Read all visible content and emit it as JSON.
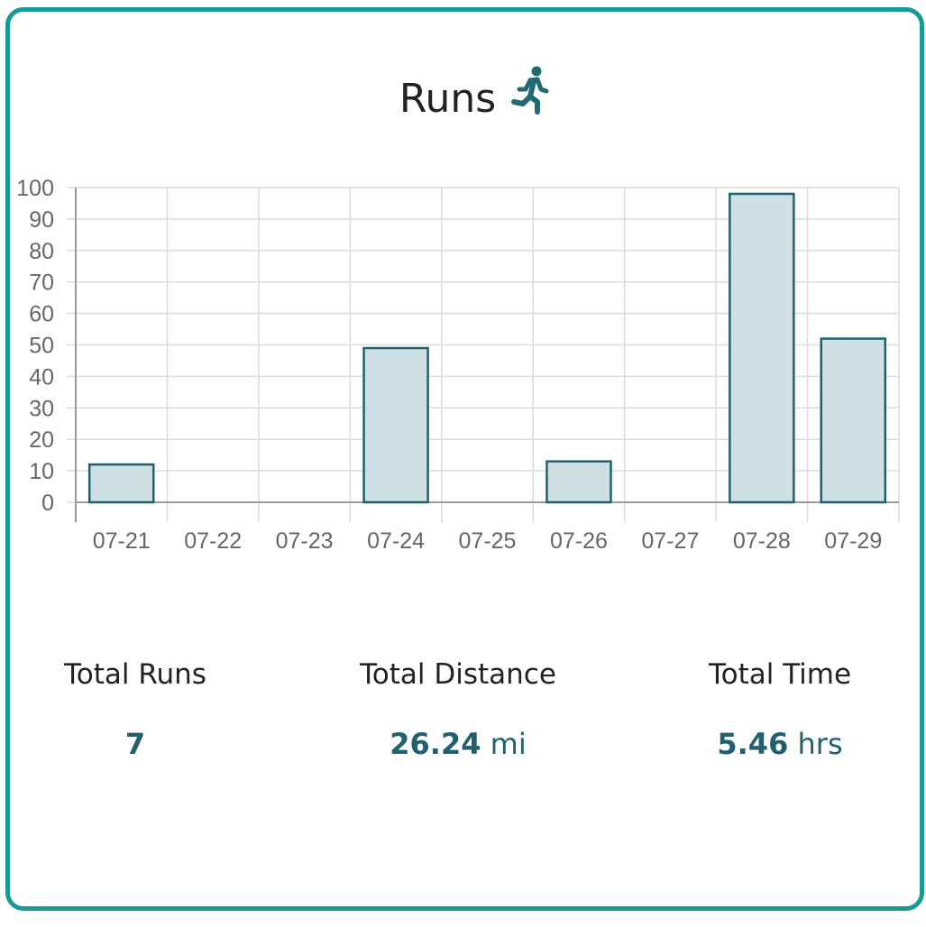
{
  "card": {
    "title": "Runs",
    "icon": "running-person-icon",
    "border_color": "#159a96",
    "accent_color": "#21616f"
  },
  "chart_data": {
    "type": "bar",
    "categories": [
      "07-21",
      "07-22",
      "07-23",
      "07-24",
      "07-25",
      "07-26",
      "07-27",
      "07-28",
      "07-29"
    ],
    "values": [
      12,
      0,
      0,
      49,
      0,
      13,
      0,
      98,
      52
    ],
    "ylim": [
      0,
      100
    ],
    "yticks": [
      0,
      10,
      20,
      30,
      40,
      50,
      60,
      70,
      80,
      90,
      100
    ],
    "grid": true,
    "bar_fill": "#cfe0e4",
    "bar_stroke": "#21616f"
  },
  "stats": [
    {
      "label": "Total Runs",
      "value": "7",
      "unit": ""
    },
    {
      "label": "Total Distance",
      "value": "26.24",
      "unit": "mi"
    },
    {
      "label": "Total Time",
      "value": "5.46",
      "unit": "hrs"
    }
  ]
}
